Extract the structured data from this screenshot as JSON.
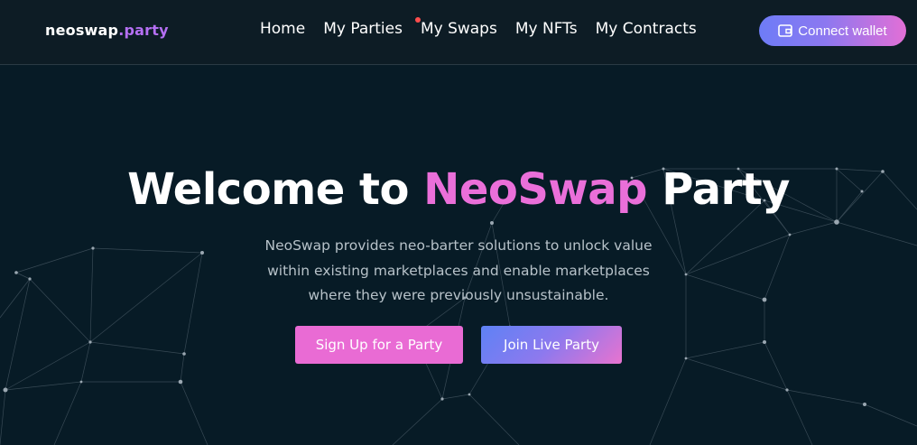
{
  "logo": {
    "brand": "neoswap",
    "tld": ".party"
  },
  "nav": {
    "items": [
      {
        "label": "Home"
      },
      {
        "label": "My Parties"
      },
      {
        "label": "My Swaps",
        "has_notification": true
      },
      {
        "label": "My NFTs"
      },
      {
        "label": "My Contracts"
      }
    ],
    "connect_wallet": {
      "label": "Connect wallet",
      "icon": "wallet-icon"
    }
  },
  "hero": {
    "title_prefix": "Welcome to ",
    "title_accent": "NeoSwap",
    "title_suffix": " Party",
    "description_lines": [
      "NeoSwap provides neo-barter solutions to unlock value",
      "within existing marketplaces and enable marketplaces",
      "where they were previously unsustainable."
    ],
    "signup_button": "Sign Up for a Party",
    "join_button": "Join Live Party"
  },
  "colors": {
    "background": "#071b26",
    "navbar": "#0d1c25",
    "accent_pink": "#ea6fd9",
    "accent_purple": "#b46ff2",
    "notification": "#ff4d4d"
  }
}
